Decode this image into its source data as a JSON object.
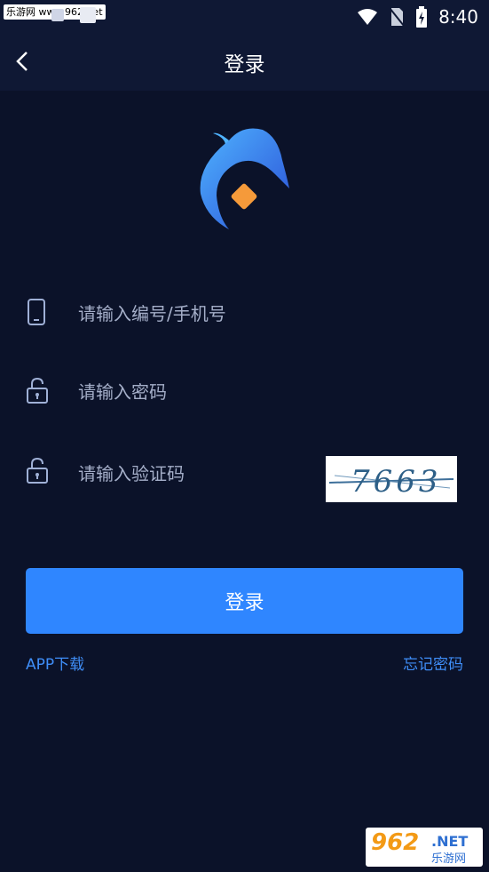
{
  "status_bar": {
    "watermark": "乐游网 www.962.net",
    "time": "8:40"
  },
  "header": {
    "title": "登录"
  },
  "form": {
    "account_placeholder": "请输入编号/手机号",
    "password_placeholder": "请输入密码",
    "captcha_placeholder": "请输入验证码",
    "captcha_text": "7663"
  },
  "login_button": "登录",
  "links": {
    "app_download": "APP下载",
    "forgot_password": "忘记密码"
  },
  "watermark_bottom": {
    "number": "962",
    "net": ".NET",
    "site_name": "乐游网"
  },
  "colors": {
    "background": "#0b1229",
    "accent": "#2f86ff",
    "link": "#3f8ef8",
    "logo_orange": "#f59a3a"
  }
}
